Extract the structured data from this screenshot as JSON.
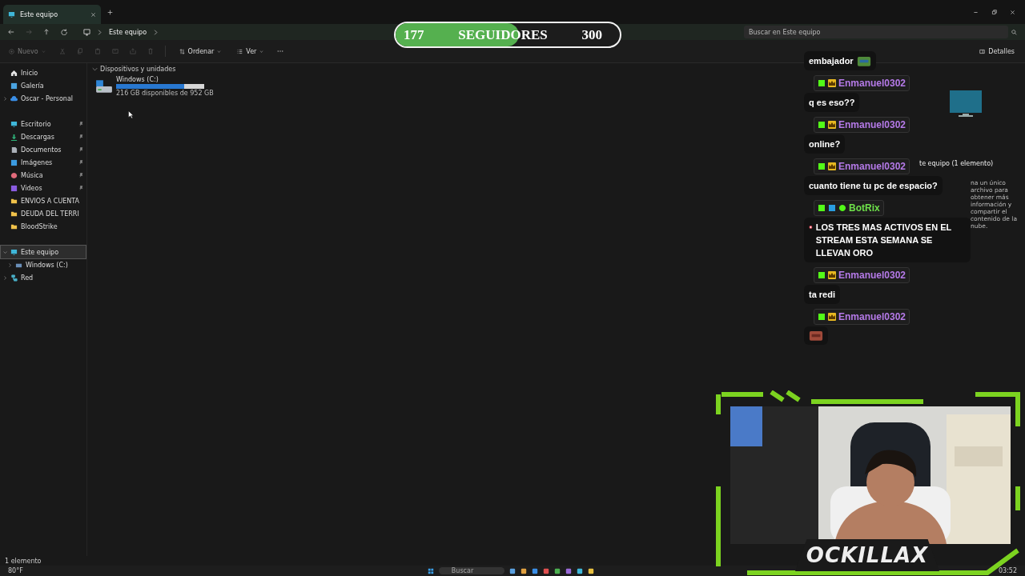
{
  "window": {
    "tab_title": "Este equipo",
    "path": [
      "Este equipo"
    ],
    "search": {
      "placeholder": "Buscar en Este equipo"
    }
  },
  "toolbar": {
    "items": [
      {
        "kind": "new",
        "label": "Nuevo",
        "disabled": true
      },
      {
        "kind": "cut",
        "disabled": true
      },
      {
        "kind": "copy",
        "disabled": true
      },
      {
        "kind": "paste",
        "disabled": true
      },
      {
        "kind": "rename",
        "disabled": true
      },
      {
        "kind": "share",
        "disabled": true
      },
      {
        "kind": "delete",
        "disabled": true
      },
      {
        "kind": "sort",
        "label": "Ordenar",
        "disabled": false
      },
      {
        "kind": "view",
        "label": "Ver",
        "disabled": false
      },
      {
        "kind": "more",
        "disabled": false
      }
    ],
    "details": "Detalles"
  },
  "sidebar": {
    "sections": [
      [
        {
          "label": "Inicio",
          "kind": "home",
          "selected": false
        },
        {
          "label": "Galería",
          "kind": "gallery",
          "selected": false
        },
        {
          "label": "Oscar - Personal",
          "kind": "cloud",
          "selected": false,
          "expanded": false
        }
      ],
      [
        {
          "label": "Escritorio",
          "kind": "desktop",
          "selected": false,
          "pinned": true
        },
        {
          "label": "Descargas",
          "kind": "download",
          "selected": false,
          "pinned": true
        },
        {
          "label": "Documentos",
          "kind": "documents",
          "selected": false,
          "pinned": true
        },
        {
          "label": "Imágenes",
          "kind": "pictures",
          "selected": false,
          "pinned": true
        },
        {
          "label": "Música",
          "kind": "music",
          "selected": false,
          "pinned": true
        },
        {
          "label": "Videos",
          "kind": "videos",
          "selected": false,
          "pinned": true
        },
        {
          "label": "ENVIOS A CUENTA",
          "kind": "folder",
          "selected": false,
          "pinned": false
        },
        {
          "label": "DEUDA DEL TERRI",
          "kind": "folder",
          "selected": false,
          "pinned": false
        },
        {
          "label": "BloodStrike",
          "kind": "folder",
          "selected": false,
          "pinned": false
        }
      ],
      [
        {
          "label": "Este equipo",
          "kind": "pc",
          "selected": true,
          "expanded": true,
          "children": [
            {
              "label": "Windows (C:)",
              "kind": "drive",
              "selected": false,
              "expanded": false
            }
          ]
        },
        {
          "label": "Red",
          "kind": "network",
          "selected": false,
          "expanded": false
        }
      ]
    ]
  },
  "content": {
    "group": "Dispositivos y unidades",
    "drives": [
      {
        "name": "Windows (C:)",
        "level": 0.77,
        "free": "216 GB disponibles de 952 GB"
      }
    ]
  },
  "details_pane": {
    "title": "te equipo (1 elemento)",
    "hint": "na un único archivo para obtener más información y compartir el contenido de la nube."
  },
  "status_bar": "1 elemento",
  "follower_goal": {
    "current": "177",
    "label": "SEGUIDORES",
    "target": "300",
    "level": 0.55
  },
  "chat": [
    {
      "text": "embajador",
      "emote": true
    },
    {
      "user": "Enmanuel0302",
      "color": "#b57ae8",
      "badges": [
        {
          "kind": "kick"
        },
        {
          "kind": "crown"
        }
      ],
      "text": "q es eso??"
    },
    {
      "user": "Enmanuel0302",
      "color": "#b57ae8",
      "badges": [
        {
          "kind": "kick"
        },
        {
          "kind": "crown"
        }
      ],
      "text": "online?"
    },
    {
      "user": "Enmanuel0302",
      "color": "#b57ae8",
      "badges": [
        {
          "kind": "kick"
        },
        {
          "kind": "crown"
        }
      ],
      "text": "cuanto tiene tu pc de espacio?"
    },
    {
      "user": "BotRix",
      "color": "#6ee04a",
      "badges": [
        {
          "kind": "kick"
        },
        {
          "kind": "bot"
        },
        {
          "kind": "verified"
        }
      ],
      "text": "LOS TRES MAS ACTIVOS EN EL STREAM ESTA SEMANA SE LLEVAN ORO",
      "target_icon": true
    },
    {
      "user": "Enmanuel0302",
      "color": "#b57ae8",
      "badges": [
        {
          "kind": "kick"
        },
        {
          "kind": "crown"
        }
      ],
      "text": "ta redi"
    },
    {
      "user": "Enmanuel0302",
      "color": "#b57ae8",
      "badges": [
        {
          "kind": "kick"
        },
        {
          "kind": "crown"
        }
      ],
      "emote": true
    }
  ],
  "webcam": {
    "logo": "OCKILLAX"
  },
  "taskbar": {
    "weather": "80°F",
    "search": "Buscar",
    "clock": "03:52"
  }
}
